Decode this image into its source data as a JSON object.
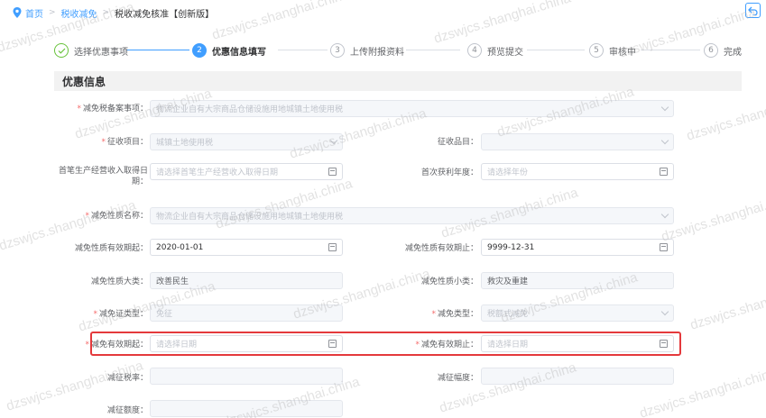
{
  "breadcrumb": {
    "home": "首页",
    "parent": "税收减免",
    "current": "税收减免核准【创新版】"
  },
  "steps": [
    {
      "num": "",
      "label": "选择优惠事项",
      "state": "done"
    },
    {
      "num": "2",
      "label": "优惠信息填写",
      "state": "active"
    },
    {
      "num": "3",
      "label": "上传附报资料",
      "state": "todo"
    },
    {
      "num": "4",
      "label": "预览提交",
      "state": "todo"
    },
    {
      "num": "5",
      "label": "审核中",
      "state": "todo"
    },
    {
      "num": "6",
      "label": "完成",
      "state": "todo"
    }
  ],
  "section_title": "优惠信息",
  "form": {
    "jmsx_label": "减免税备案事项：",
    "jmsx_value": "物流企业自有大宗商品仓储设施用地城镇土地使用税",
    "zsxm_label": "征收项目：",
    "zsxm_value": "城镇土地使用税",
    "zspm_label": "征收品目：",
    "zspm_value": "",
    "scsr_label": "首笔生产经营收入取得日期：",
    "scsr_placeholder": "请选择首笔生产经营收入取得日期",
    "schl_label": "首次获利年度：",
    "schl_placeholder": "请选择年份",
    "jmxz_label": "减免性质名称：",
    "jmxz_value": "物流企业自有大宗商品仓储设施用地城镇土地使用税",
    "yxqq_label": "减免性质有效期起：",
    "yxqq_value": "2020-01-01",
    "yxqz_label": "减免性质有效期止：",
    "yxqz_value": "9999-12-31",
    "dl_label": "减免性质大类：",
    "dl_value": "改善民生",
    "xl_label": "减免性质小类：",
    "xl_value": "救灾及重建",
    "jmzlx_label": "减免证类型：",
    "jmzlx_value": "免征",
    "jmlx_label": "减免类型：",
    "jmlx_value": "税额式减免",
    "jmqq_label": "减免有效期起：",
    "jmqq_placeholder": "请选择日期",
    "jmqz_label": "减免有效期止：",
    "jmqz_placeholder": "请选择日期",
    "jzsz_label": "减征税率：",
    "jzfd_label": "减征幅度：",
    "jzee_label": "减征额度："
  },
  "watermark_text": "dzswjcs.shanghai.china",
  "colors": {
    "accent": "#409eff",
    "required": "#f56c6c",
    "highlight": "#e4393c"
  }
}
